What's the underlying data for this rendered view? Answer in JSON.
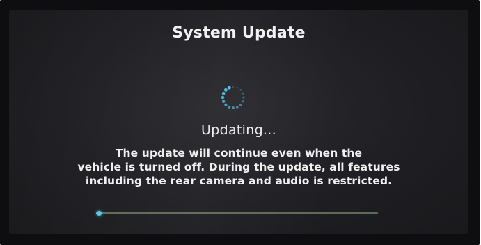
{
  "screen": {
    "title": "System Update",
    "status": "Updating...",
    "message_lines": [
      "The update will continue even when the",
      "vehicle is turned off. During the update, all features",
      "including the rear camera and audio is restricted."
    ],
    "progress": 0.01,
    "spinner_icon": "loading-spinner-icon"
  },
  "colors": {
    "background": "#1f1f23",
    "text": "#f0f0f0",
    "accent": "#53c7ec",
    "progress_track": "#5d6b57"
  }
}
